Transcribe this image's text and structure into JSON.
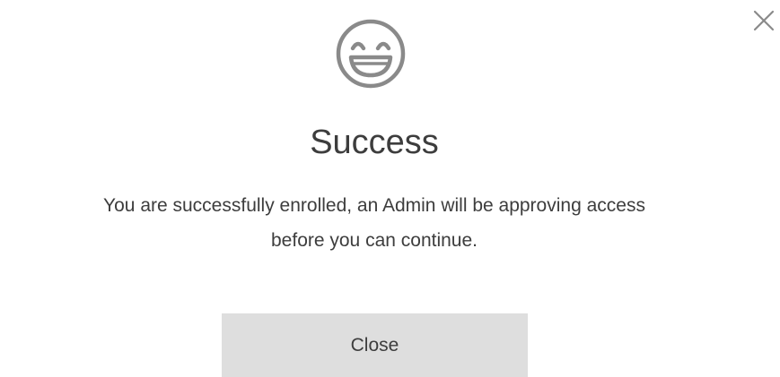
{
  "dialog": {
    "close_icon": "close-icon",
    "status_icon": "smiley-face-icon",
    "title": "Success",
    "message_line1": "You are successfully enrolled, an Admin will be approving access",
    "message_line2": "before you can continue.",
    "close_button_label": "Close"
  },
  "colors": {
    "text": "#3d3d3d",
    "icon": "#8a8a8a",
    "button_bg": "#dedede",
    "background": "#ffffff"
  }
}
